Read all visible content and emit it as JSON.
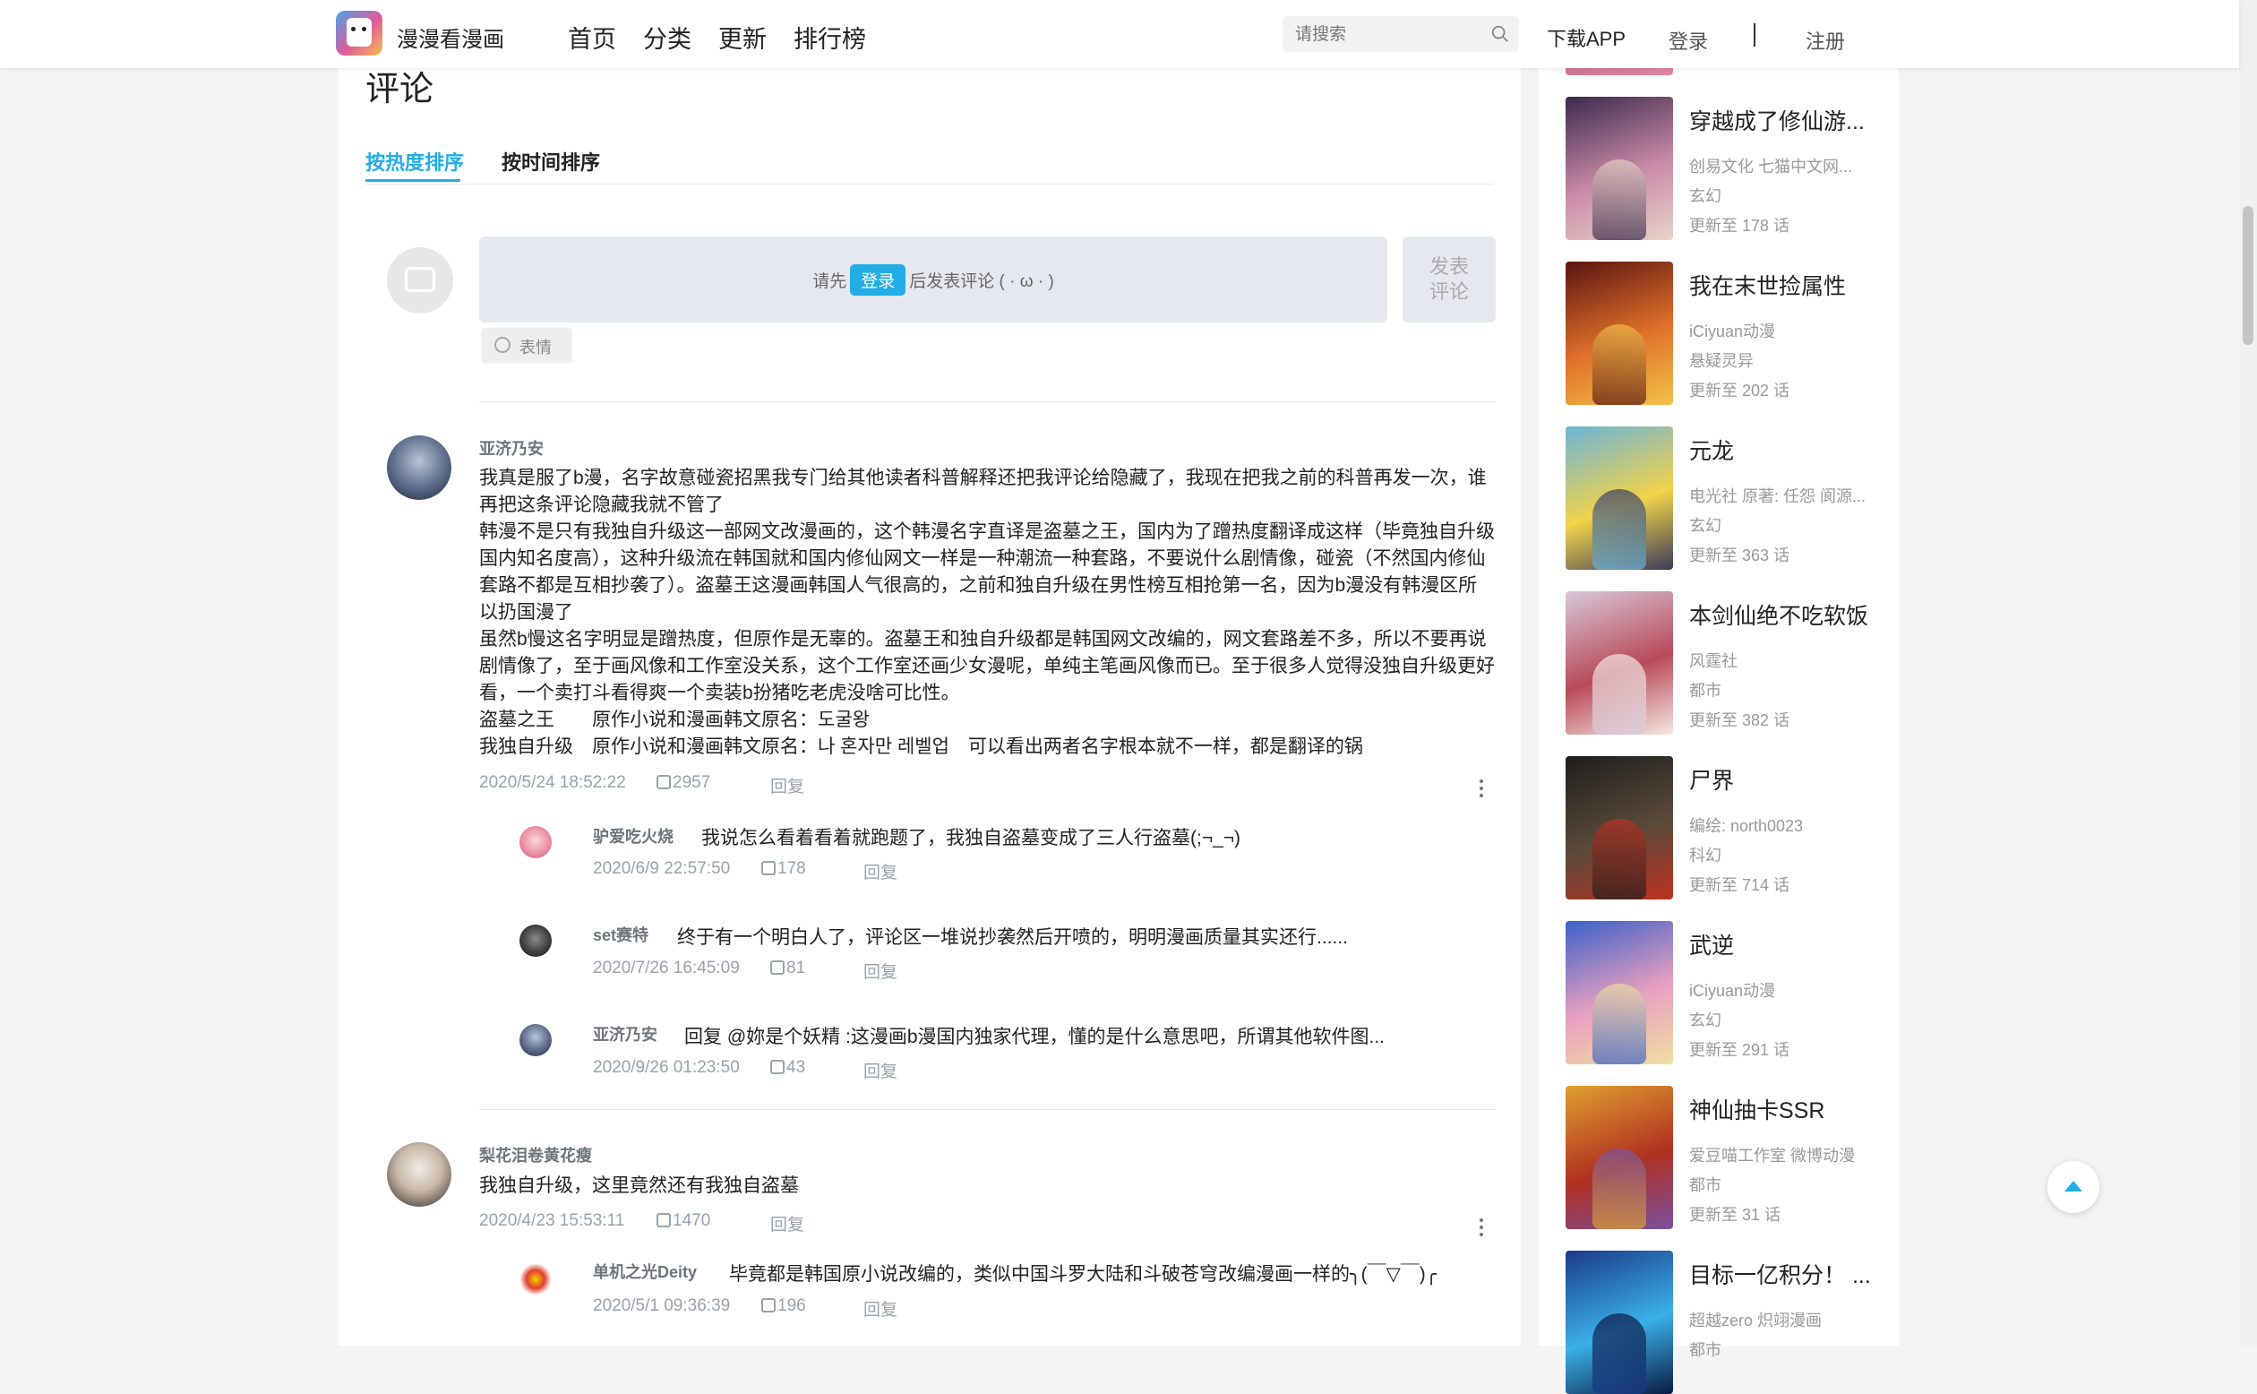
{
  "header": {
    "logo_text": "漫漫看漫画",
    "nav": [
      "首页",
      "分类",
      "更新",
      "排行榜"
    ],
    "search_placeholder": "请搜索",
    "download": "下载APP",
    "login": "登录",
    "divider": "|",
    "register": "注册"
  },
  "comments_section": {
    "title": "评论",
    "tabs": [
      "按热度排序",
      "按时间排序"
    ],
    "input_hint_pre": "请先",
    "input_login": "登录",
    "input_hint_post": "后发表评论 ( · ω · )",
    "post_button_l1": "发表",
    "post_button_l2": "评论",
    "emoji_button": "表情"
  },
  "comments": [
    {
      "user": "亚济乃安",
      "paragraphs": [
        "我真是服了b漫，名字故意碰瓷招黑我专门给其他读者科普解释还把我评论给隐藏了，我现在把我之前的科普再发一次，谁再把这条评论隐藏我就不管了",
        "韩漫不是只有我独自升级这一部网文改漫画的，这个韩漫名字直译是盗墓之王，国内为了蹭热度翻译成这样（毕竟独自升级国内知名度高），这种升级流在韩国就和国内修仙网文一样是一种潮流一种套路，不要说什么剧情像，碰瓷（不然国内修仙套路不都是互相抄袭了）。盗墓王这漫画韩国人气很高的，之前和独自升级在男性榜互相抢第一名，因为b漫没有韩漫区所以扔国漫了",
        "虽然b慢这名字明显是蹭热度，但原作是无辜的。盗墓王和独自升级都是韩国网文改编的，网文套路差不多，所以不要再说剧情像了，至于画风像和工作室没关系，这个工作室还画少女漫呢，单纯主笔画风像而已。至于很多人觉得没独自升级更好看，一个卖打斗看得爽一个卖装b扮猪吃老虎没啥可比性。",
        "盗墓之王　　原作小说和漫画韩文原名：도굴왕",
        "我独自升级　原作小说和漫画韩文原名：나 혼자만 레벨업　可以看出两者名字根本就不一样，都是翻译的锅"
      ],
      "time": "2020/5/24 18:52:22",
      "likes": "2957",
      "reply": "回复",
      "replies": [
        {
          "user": "驴爱吃火烧",
          "text": "我说怎么看着看着就跑题了，我独自盗墓变成了三人行盗墓(;¬_¬)",
          "time": "2020/6/9 22:57:50",
          "likes": "178",
          "reply": "回复"
        },
        {
          "user": "set赛特",
          "text": "终于有一个明白人了，评论区一堆说抄袭然后开喷的，明明漫画质量其实还行......",
          "time": "2020/7/26 16:45:09",
          "likes": "81",
          "reply": "回复"
        },
        {
          "user": "亚济乃安",
          "text": "回复 @妳是个妖精 :这漫画b漫国内独家代理，懂的是什么意思吧，所谓其他软件图...",
          "time": "2020/9/26 01:23:50",
          "likes": "43",
          "reply": "回复"
        }
      ]
    },
    {
      "user": "梨花泪卷黄花瘦",
      "paragraphs": [
        "我独自升级，这里竟然还有我独自盗墓"
      ],
      "time": "2020/4/23 15:53:11",
      "likes": "1470",
      "reply": "回复",
      "replies": [
        {
          "user": "单机之光Deity",
          "text": "毕竟都是韩国原小说改编的，类似中国斗罗大陆和斗破苍穹改编漫画一样的╮(￣▽￣)╭",
          "time": "2020/5/1 09:36:39",
          "likes": "196",
          "reply": "回复"
        }
      ]
    }
  ],
  "sidebar": [
    {
      "title": "穿越成了修仙游...",
      "meta1": "创易文化  七猫中文网...",
      "meta2": "玄幻",
      "meta3": "更新至 178 话",
      "colors": [
        "#3b2a4a",
        "#c98aa8",
        "#e8d4c8"
      ]
    },
    {
      "title": "我在末世捡属性",
      "meta1": "iCiyuan动漫",
      "meta2": "悬疑灵异",
      "meta3": "更新至 202 话",
      "colors": [
        "#5a1410",
        "#e0702a",
        "#f3c24a"
      ]
    },
    {
      "title": "元龙",
      "meta1": "电光社  原著: 任怨  阆源...",
      "meta2": "玄幻",
      "meta3": "更新至 363 话",
      "colors": [
        "#6bb4d9",
        "#f2d34a",
        "#3a3a5a"
      ]
    },
    {
      "title": "本剑仙绝不吃软饭",
      "meta1": "风霆社",
      "meta2": "都市",
      "meta3": "更新至 382 话",
      "colors": [
        "#d8c8d8",
        "#b84a5a",
        "#f5e8e0"
      ]
    },
    {
      "title": "尸界",
      "meta1": "编绘: north0023",
      "meta2": "科幻",
      "meta3": "更新至 714 话",
      "colors": [
        "#1e1e1e",
        "#5a4a3a",
        "#c03020"
      ]
    },
    {
      "title": "武逆",
      "meta1": "iCiyuan动漫",
      "meta2": "玄幻",
      "meta3": "更新至 291 话",
      "colors": [
        "#3a60c8",
        "#e8a0c0",
        "#f0e0a0"
      ]
    },
    {
      "title": "神仙抽卡SSR",
      "meta1": "爱豆喵工作室  微博动漫",
      "meta2": "都市",
      "meta3": "更新至 31 话",
      "colors": [
        "#e0a030",
        "#b03020",
        "#7a50a0"
      ]
    },
    {
      "title": "目标一亿积分！ ...",
      "meta1": "超越zero  炽翊漫画",
      "meta2": "都市",
      "meta3": "",
      "colors": [
        "#1a3a8a",
        "#3ab0e8",
        "#0a1a40"
      ]
    }
  ]
}
